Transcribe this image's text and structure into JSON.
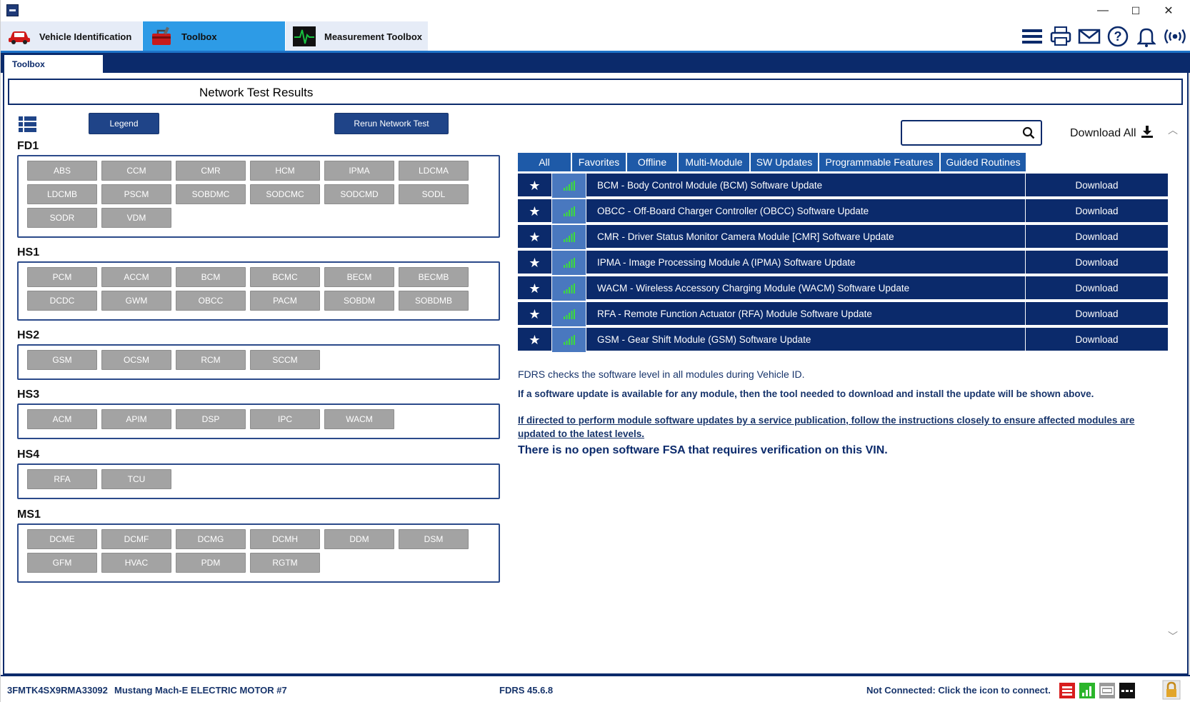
{
  "window": {
    "minimize": "—",
    "maximize": "☐",
    "close": "✕"
  },
  "main_tabs": [
    {
      "label": "Vehicle Identification"
    },
    {
      "label": "Toolbox"
    },
    {
      "label": "Measurement Toolbox"
    }
  ],
  "toolbar_icons": [
    "menu-icon",
    "print-icon",
    "mail-icon",
    "help-icon",
    "bell-icon",
    "connection-icon"
  ],
  "sub_tab": "Toolbox",
  "page_title": "Network Test Results",
  "buttons": {
    "legend": "Legend",
    "rerun": "Rerun Network Test"
  },
  "groups": [
    {
      "name": "FD1",
      "modules": [
        "ABS",
        "CCM",
        "CMR",
        "HCM",
        "IPMA",
        "LDCMA",
        "LDCMB",
        "PSCM",
        "SOBDMC",
        "SODCMC",
        "SODCMD",
        "SODL",
        "SODR",
        "VDM"
      ]
    },
    {
      "name": "HS1",
      "modules": [
        "PCM",
        "ACCM",
        "BCM",
        "BCMC",
        "BECM",
        "BECMB",
        "DCDC",
        "GWM",
        "OBCC",
        "PACM",
        "SOBDM",
        "SOBDMB"
      ]
    },
    {
      "name": "HS2",
      "modules": [
        "GSM",
        "OCSM",
        "RCM",
        "SCCM"
      ]
    },
    {
      "name": "HS3",
      "modules": [
        "ACM",
        "APIM",
        "DSP",
        "IPC",
        "WACM"
      ]
    },
    {
      "name": "HS4",
      "modules": [
        "RFA",
        "TCU"
      ]
    },
    {
      "name": "MS1",
      "modules": [
        "DCME",
        "DCMF",
        "DCMG",
        "DCMH",
        "DDM",
        "DSM",
        "GFM",
        "HVAC",
        "PDM",
        "RGTM"
      ]
    }
  ],
  "search": {
    "placeholder": ""
  },
  "download_all": "Download All",
  "filter_tabs": [
    "All",
    "Favorites",
    "Offline",
    "Multi-Module",
    "SW Updates",
    "Programmable Features",
    "Guided Routines"
  ],
  "updates": [
    {
      "name": "BCM - Body Control Module (BCM) Software Update",
      "action": "Download"
    },
    {
      "name": "OBCC - Off-Board Charger Controller (OBCC) Software Update",
      "action": "Download"
    },
    {
      "name": "CMR - Driver Status Monitor Camera Module [CMR] Software Update",
      "action": "Download"
    },
    {
      "name": "IPMA - Image Processing Module A (IPMA) Software Update",
      "action": "Download"
    },
    {
      "name": "WACM - Wireless Accessory Charging Module (WACM) Software Update",
      "action": "Download"
    },
    {
      "name": "RFA - Remote Function Actuator (RFA) Module Software Update",
      "action": "Download"
    },
    {
      "name": "GSM - Gear Shift Module (GSM) Software Update",
      "action": "Download"
    }
  ],
  "info": {
    "line1": "FDRS checks the software level in all modules during Vehicle ID.",
    "line2": "If a software update is available for any module, then the tool needed to download and install the update will be shown above.",
    "line3": "If directed to perform module software updates by a service publication, follow the instructions closely to ensure affected modules are updated to the latest levels.",
    "line4": "There is no open software FSA that requires verification on this VIN."
  },
  "status": {
    "vin": "3FMTK4SX9RMA33092",
    "vehicle": "Mustang Mach-E ELECTRIC MOTOR #7",
    "version": "FDRS 45.6.8",
    "connection": "Not Connected: Click the icon to connect."
  },
  "colors": {
    "navy": "#0b2a6b",
    "tab_blue": "#1e5aa8",
    "module_gray": "#a3a3a3",
    "active_tab": "#2d9be6",
    "inactive_tab": "#e6ecf7"
  }
}
